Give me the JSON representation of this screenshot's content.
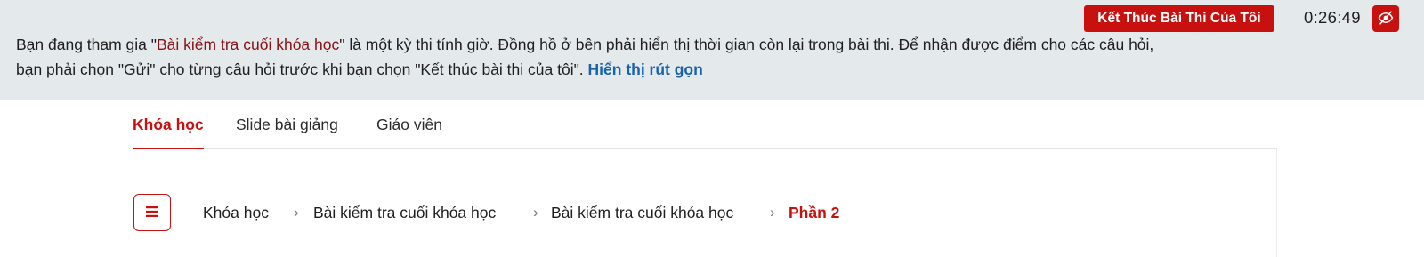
{
  "banner": {
    "text_before": "Bạn đang tham gia \"",
    "exam_name": "Bài kiểm tra cuối khóa học",
    "text_after": "\" là một kỳ thi tính giờ. Đồng hồ ở bên phải hiển thị thời gian còn lại trong bài thi. Để nhận được điểm cho các câu hỏi, bạn phải chọn \"Gửi\" cho từng câu hỏi trước khi bạn chọn \"Kết thúc bài thi của tôi\". ",
    "toggle_label": "Hiển thị rút gọn"
  },
  "exam_controls": {
    "end_button_label": "Kết Thúc Bài Thi Của Tôi",
    "timer": "0:26:49",
    "hide_timer_icon": "eye-slash-icon"
  },
  "tabs": [
    {
      "label": "Khóa học",
      "active": true
    },
    {
      "label": "Slide bài giảng",
      "active": false
    },
    {
      "label": "Giáo viên",
      "active": false
    }
  ],
  "menu_toggle_icon": "hamburger-menu-icon",
  "breadcrumb": {
    "separator_icon": "chevron-right-icon",
    "items": [
      {
        "label": "Khóa học"
      },
      {
        "label": "Bài kiểm tra cuối khóa học"
      },
      {
        "label": "Bài kiểm tra cuối khóa học"
      },
      {
        "label": "Phần 2",
        "current": true
      }
    ]
  },
  "colors": {
    "accent": "#c8100f",
    "banner_bg": "#e4e9ec",
    "link": "#1a63a8",
    "exam_name": "#8a1215"
  }
}
